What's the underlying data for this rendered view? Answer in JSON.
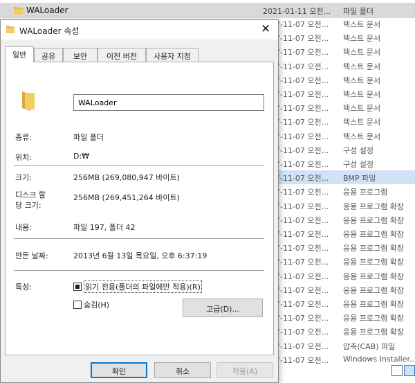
{
  "explorer": {
    "top_row": {
      "name": "WALoader",
      "date": "2021-01-11 오전...",
      "type": "파일 폴더"
    },
    "rows": [
      {
        "date": "7-11-07 오전...",
        "type": "텍스트 문서"
      },
      {
        "date": "7-11-07 오전...",
        "type": "텍스트 문서"
      },
      {
        "date": "7-11-07 오전...",
        "type": "텍스트 문서"
      },
      {
        "date": "7-11-07 오전...",
        "type": "텍스트 문서"
      },
      {
        "date": "7-11-07 오전...",
        "type": "텍스트 문서"
      },
      {
        "date": "7-11-07 오전...",
        "type": "텍스트 문서"
      },
      {
        "date": "7-11-07 오전...",
        "type": "텍스트 문서"
      },
      {
        "date": "7-11-07 오전...",
        "type": "텍스트 문서"
      },
      {
        "date": "7-11-07 오전...",
        "type": "텍스트 문서"
      },
      {
        "date": "7-11-07 오전...",
        "type": "구성 설정"
      },
      {
        "date": "7-11-07 오전...",
        "type": "구성 설정"
      },
      {
        "date": "7-11-07 오전...",
        "type": "BMP 파일"
      },
      {
        "date": "7-11-07 오전...",
        "type": "응용 프로그램"
      },
      {
        "date": "7-11-07 오전...",
        "type": "응용 프로그램 확장"
      },
      {
        "date": "7-11-07 오전...",
        "type": "응용 프로그램 확장"
      },
      {
        "date": "7-11-07 오전...",
        "type": "응용 프로그램 확장"
      },
      {
        "date": "7-11-07 오전...",
        "type": "응용 프로그램 확장"
      },
      {
        "date": "7-11-07 오전...",
        "type": "응용 프로그램 확장"
      },
      {
        "date": "7-11-07 오전...",
        "type": "응용 프로그램 확장"
      },
      {
        "date": "7-11-07 오전...",
        "type": "응용 프로그램 확장"
      },
      {
        "date": "7-11-07 오전...",
        "type": "응용 프로그램 확장"
      },
      {
        "date": "7-11-07 오전...",
        "type": "응용 프로그램 확장"
      },
      {
        "date": "7-11-07 오전...",
        "type": "응용 프로그램 확장"
      },
      {
        "date": "7-11-07 오전...",
        "type": "압축(CAB) 파일"
      },
      {
        "date": "7-11-07 오전...",
        "type": "Windows Installer..."
      }
    ]
  },
  "dialog": {
    "title": "WALoader 속성",
    "close_glyph": "✕",
    "tabs": [
      "일반",
      "공유",
      "보안",
      "이전 버전",
      "사용자 지정"
    ],
    "name_value": "WALoader",
    "fields": {
      "type_label": "종류:",
      "type_value": "파일 폴더",
      "location_label": "위치:",
      "location_value": "D:₩",
      "size_label": "크기:",
      "size_value": "256MB (269,080,947 바이트)",
      "disk_label_1": "디스크 할",
      "disk_label_2": "당 크기:",
      "disk_value": "256MB (269,451,264 바이트)",
      "contents_label": "내용:",
      "contents_value": "파일 197, 폴더 42",
      "created_label": "만든 날짜:",
      "created_value": "2013년 6월 13일 목요일, 오후 6:37:19",
      "attributes_label": "특성:"
    },
    "readonly_label": "읽기 전용(폴더의 파일에만 적용)(R)",
    "hidden_label": "숨김(H)",
    "advanced_label": "고급(D)...",
    "buttons": {
      "ok": "확인",
      "cancel": "취소",
      "apply": "적용(A)"
    }
  },
  "colors": {
    "accent": "#0078d7",
    "selected_row": "#d0e3f5",
    "folder": "#e8b948"
  }
}
